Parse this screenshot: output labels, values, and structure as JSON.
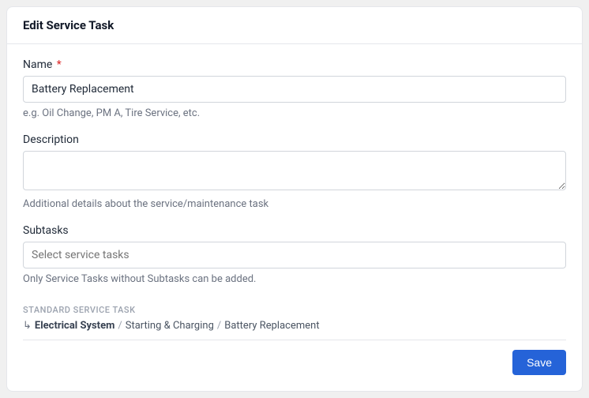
{
  "header": {
    "title": "Edit Service Task"
  },
  "fields": {
    "name": {
      "label": "Name",
      "required_marker": "*",
      "value": "Battery Replacement",
      "help": "e.g. Oil Change, PM A, Tire Service, etc."
    },
    "description": {
      "label": "Description",
      "value": "",
      "help": "Additional details about the service/maintenance task"
    },
    "subtasks": {
      "label": "Subtasks",
      "placeholder": "Select service tasks",
      "help": "Only Service Tasks without Subtasks can be added."
    }
  },
  "standard_task": {
    "section_label": "STANDARD SERVICE TASK",
    "arrow": "↳",
    "separator": "/",
    "parts": {
      "p1": "Electrical System",
      "p2": "Starting & Charging",
      "p3": "Battery Replacement"
    }
  },
  "actions": {
    "save": "Save"
  }
}
